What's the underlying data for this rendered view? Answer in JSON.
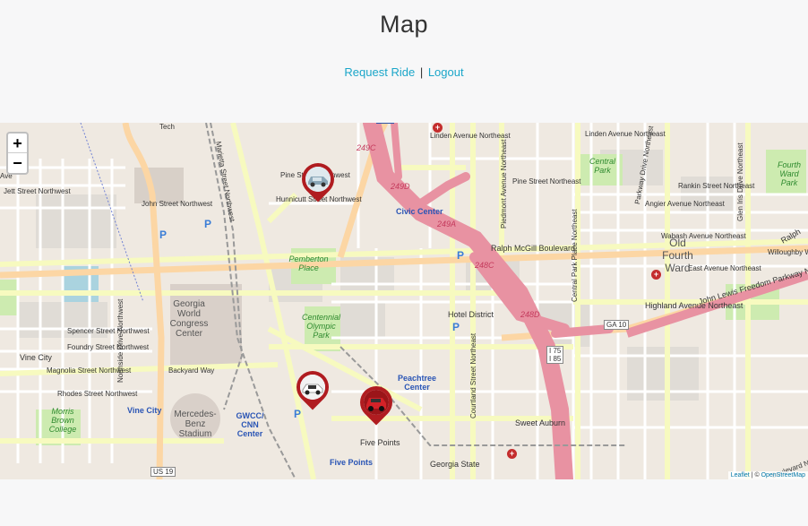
{
  "header": {
    "title": "Map"
  },
  "nav": {
    "request_ride": "Request Ride",
    "separator": "|",
    "logout": "Logout"
  },
  "map": {
    "zoom_in": "+",
    "zoom_out": "−",
    "attribution": {
      "leaflet": "Leaflet",
      "sep": " | © ",
      "osm": "OpenStreetMap"
    },
    "big_labels": [
      "Old Fourth Ward"
    ],
    "area_labels": [
      "Georgia World Congress Center",
      "Mercedes-Benz Stadium",
      "Hotel District"
    ],
    "blue_labels": [
      "Civic Center",
      "Vine City",
      "GWCC/ CNN Center",
      "Peachtree Center",
      "Five Points"
    ],
    "park_labels": [
      "Central Park",
      "Fourth Ward Park",
      "Pemberton Place",
      "Centennial Olympic Park",
      "Morris Brown College"
    ],
    "highway_labels": [
      "249C",
      "249D",
      "249A",
      "248C",
      "248D"
    ],
    "shields": [
      "GA 10",
      "I 75\nI 85",
      "US 19"
    ],
    "street_labels": [
      "Tech",
      "Linden Avenue Northeast",
      "Linden Avenue Northeast",
      "Pine Street Northwest",
      "Pine Street Northeast",
      "Hunnicutt Street Northwest",
      "John Street Northwest",
      "Ralph McGill Boulevard",
      "Rankin Street Northeast",
      "Angier Avenue Northeast",
      "Wabash Avenue Northeast",
      "East Avenue Northeast",
      "Willoughby Way",
      "Highland Avenue Northeast",
      "John Lewis Freedom Parkway Northeast",
      "Spencer Street Northwest",
      "Foundry Street Northwest",
      "Vine City",
      "Magnolia Street Northwest",
      "Rhodes Street Northwest",
      "Backyard Way",
      "Sweet Auburn",
      "Georgia State",
      "Five Points",
      "Jett Street Northwest",
      "Ave",
      "Northside Drive Northwest",
      "Marietta Street Northwest",
      "Courtland Street Northeast",
      "Piedmont Avenue Northeast",
      "Central Park Place Northeast",
      "Parkway Drive Northeast",
      "Glen Iris Drive Northeast",
      "Boulevard Northeast",
      "Ralph"
    ],
    "markers": [
      {
        "name": "driver-car-1",
        "color": "#b01c20",
        "car_color": "#9fb8c8"
      },
      {
        "name": "driver-car-2",
        "color": "#b01c20",
        "car_color": "#ffffff"
      },
      {
        "name": "driver-car-3",
        "color": "#b01c20",
        "car_color": "#c81f24"
      }
    ]
  }
}
